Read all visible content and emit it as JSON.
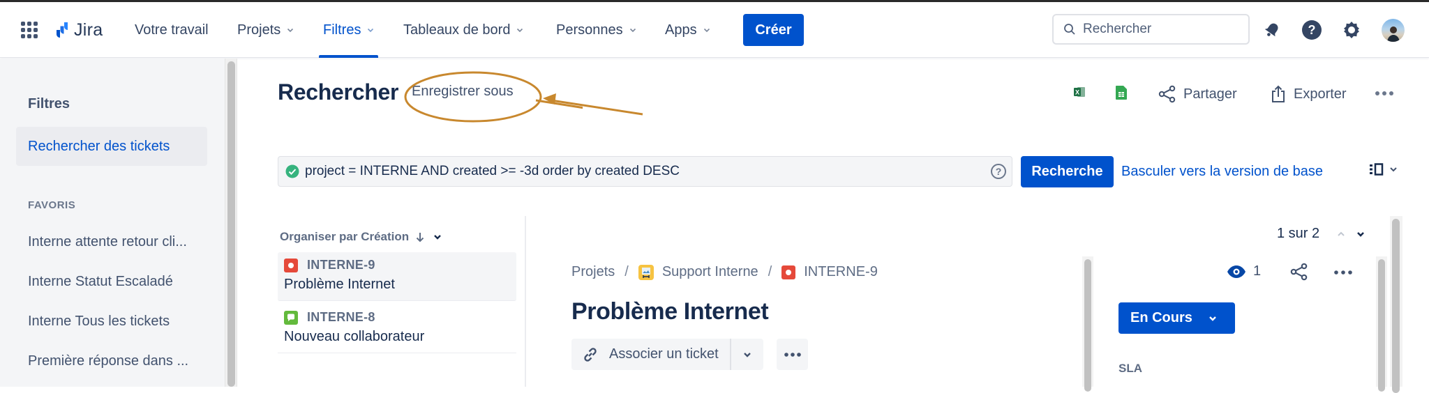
{
  "nav": {
    "app_name": "Jira",
    "items": [
      {
        "label": "Votre travail",
        "dropdown": false,
        "active": false
      },
      {
        "label": "Projets",
        "dropdown": true,
        "active": false
      },
      {
        "label": "Filtres",
        "dropdown": true,
        "active": true
      },
      {
        "label": "Tableaux de bord",
        "dropdown": true,
        "active": false
      },
      {
        "label": "Personnes",
        "dropdown": true,
        "active": false
      },
      {
        "label": "Apps",
        "dropdown": true,
        "active": false
      }
    ],
    "create_label": "Créer",
    "search_placeholder": "Rechercher",
    "icons": [
      "app-switcher-icon",
      "notifications-icon",
      "help-icon",
      "settings-icon",
      "avatar"
    ]
  },
  "sidebar": {
    "title": "Filtres",
    "active_item": "Rechercher des tickets",
    "section_label": "FAVORIS",
    "favorites": [
      "Interne attente retour cli...",
      "Interne Statut Escaladé",
      "Interne Tous les tickets",
      "Première réponse dans ..."
    ]
  },
  "header": {
    "title": "Rechercher",
    "save_as_label": "Enregistrer sous",
    "actions": {
      "excel_icon": "excel-icon",
      "sheets_icon": "google-sheets-icon",
      "share_label": "Partager",
      "export_label": "Exporter"
    }
  },
  "annotation": {
    "color": "#c8882e",
    "target": "Enregistrer sous"
  },
  "jql": {
    "query": "project = INTERNE AND created >= -3d order by created DESC",
    "valid": true,
    "help_label": "?",
    "search_label": "Recherche",
    "basic_link": "Basculer vers la version de base"
  },
  "list": {
    "order_label": "Organiser par Création",
    "issues": [
      {
        "key": "INTERNE-9",
        "summary": "Problème Internet",
        "type": "incident",
        "type_color": "#e5493a",
        "selected": true
      },
      {
        "key": "INTERNE-8",
        "summary": "Nouveau collaborateur",
        "type": "service-request",
        "type_color": "#63ba3c",
        "selected": false
      }
    ]
  },
  "pager": {
    "label": "1 sur 2"
  },
  "issue": {
    "breadcrumb": [
      "Projets",
      "Support Interne",
      "INTERNE-9"
    ],
    "title": "Problème Internet",
    "link_label": "Associer un ticket",
    "watchers": "1",
    "status": "En Cours",
    "sla_label": "SLA"
  },
  "colors": {
    "primary": "#0052cc",
    "text": "#172b4d",
    "subtle": "#42526e",
    "sidebar_bg": "#f4f5f7"
  }
}
